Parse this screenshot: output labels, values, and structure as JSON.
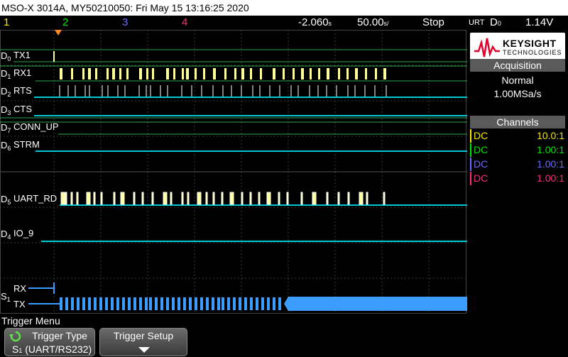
{
  "title_bar": "MSO-X 3014A, MY50210050: Fri May 15 13:16:25 2020",
  "status_bar": {
    "channels": [
      {
        "num": "1",
        "color": "#f4e600"
      },
      {
        "num": "2",
        "color": "#00e800"
      },
      {
        "num": "3",
        "color": "#6a6aff"
      },
      {
        "num": "4",
        "color": "#ff2a80"
      }
    ],
    "time_offset": "-2.060",
    "time_offset_unit": "s",
    "time_scale": "50.00",
    "time_scale_unit": "s/",
    "run_state": "Stop",
    "trigger_mode": "URT",
    "trigger_source": "D",
    "trigger_source_sub": "0",
    "trigger_level": "1.14V"
  },
  "digital_channels": [
    {
      "id": "D",
      "sub": "0",
      "label": "TX1"
    },
    {
      "id": "D",
      "sub": "1",
      "label": "RX1"
    },
    {
      "id": "D",
      "sub": "2",
      "label": "RTS"
    },
    {
      "id": "D",
      "sub": "3",
      "label": "CTS"
    },
    {
      "id": "D",
      "sub": "7",
      "label": "CONN_UP"
    },
    {
      "id": "D",
      "sub": "6",
      "label": "STRM"
    },
    {
      "id": "D",
      "sub": "5",
      "label": "UART_RD"
    },
    {
      "id": "D",
      "sub": "4",
      "label": "IO_9"
    }
  ],
  "serial_bus": {
    "id": "S",
    "sub": "1",
    "rx_label": "RX",
    "tx_label": "TX"
  },
  "logo": {
    "brand": "KEYSIGHT",
    "sub": "TECHNOLOGIES"
  },
  "acquisition": {
    "header": "Acquisition",
    "mode": "Normal",
    "rate": "1.00MSa/s"
  },
  "channels_panel": {
    "header": "Channels",
    "rows": [
      {
        "coupling": "DC",
        "scale": "10.0:1",
        "color": "#f4e600"
      },
      {
        "coupling": "DC",
        "scale": "1.00:1",
        "color": "#00e800"
      },
      {
        "coupling": "DC",
        "scale": "1.00:1",
        "color": "#6a6aff"
      },
      {
        "coupling": "DC",
        "scale": "1.00:1",
        "color": "#ff2a80"
      }
    ]
  },
  "menu": {
    "title": "Trigger Menu",
    "softkeys": [
      {
        "label": "Trigger Type",
        "sub_prefix": "S",
        "sub_index": "1",
        "sub_value": "(UART/RS232)"
      },
      {
        "label": "Trigger Setup"
      }
    ]
  },
  "colors": {
    "digital_high": "#ffff99",
    "digital_low": "#00c8d8",
    "serial": "#3a9dff",
    "grid": "#3a3a3a"
  }
}
